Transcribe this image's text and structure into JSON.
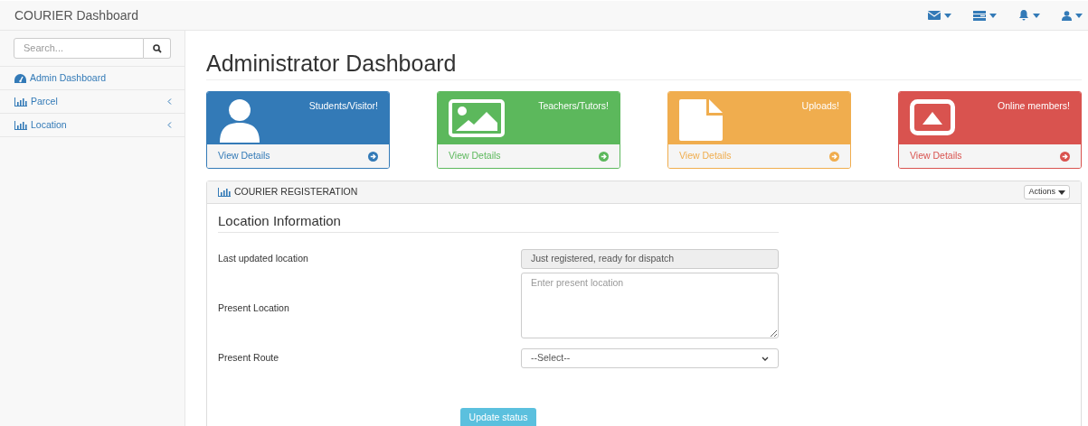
{
  "navbar": {
    "brand": "COURIER Dashboard"
  },
  "sidebar": {
    "search": {
      "placeholder": "Search..."
    },
    "items": [
      {
        "label": "Admin Dashboard",
        "kind": "dashboard"
      },
      {
        "label": "Parcel",
        "kind": "submenu"
      },
      {
        "label": "Location",
        "kind": "submenu"
      }
    ]
  },
  "page_title": "Administrator Dashboard",
  "cards": [
    {
      "title": "Students/Visitor!",
      "kind": "user",
      "color": "#337ab7",
      "link": "View Details"
    },
    {
      "title": "Teachers/Tutors!",
      "kind": "image",
      "color": "#5cb85c",
      "link": "View Details"
    },
    {
      "title": "Uploads!",
      "kind": "file",
      "color": "#f0ad4e",
      "link": "View Details"
    },
    {
      "title": "Online members!",
      "kind": "caret-square",
      "color": "#d9534f",
      "link": "View Details"
    }
  ],
  "panel": {
    "heading": "COURIER REGISTERATION",
    "actions": "Actions",
    "form": {
      "title": "Location Information",
      "fields": [
        {
          "kind": "readonly",
          "label": "Last updated location",
          "value": "Just registered, ready for dispatch"
        },
        {
          "kind": "textarea",
          "label": "Present Location",
          "placeholder": "Enter present location"
        },
        {
          "kind": "select",
          "label": "Present Route",
          "value": "--Select--"
        }
      ],
      "submit": "Update status"
    }
  }
}
